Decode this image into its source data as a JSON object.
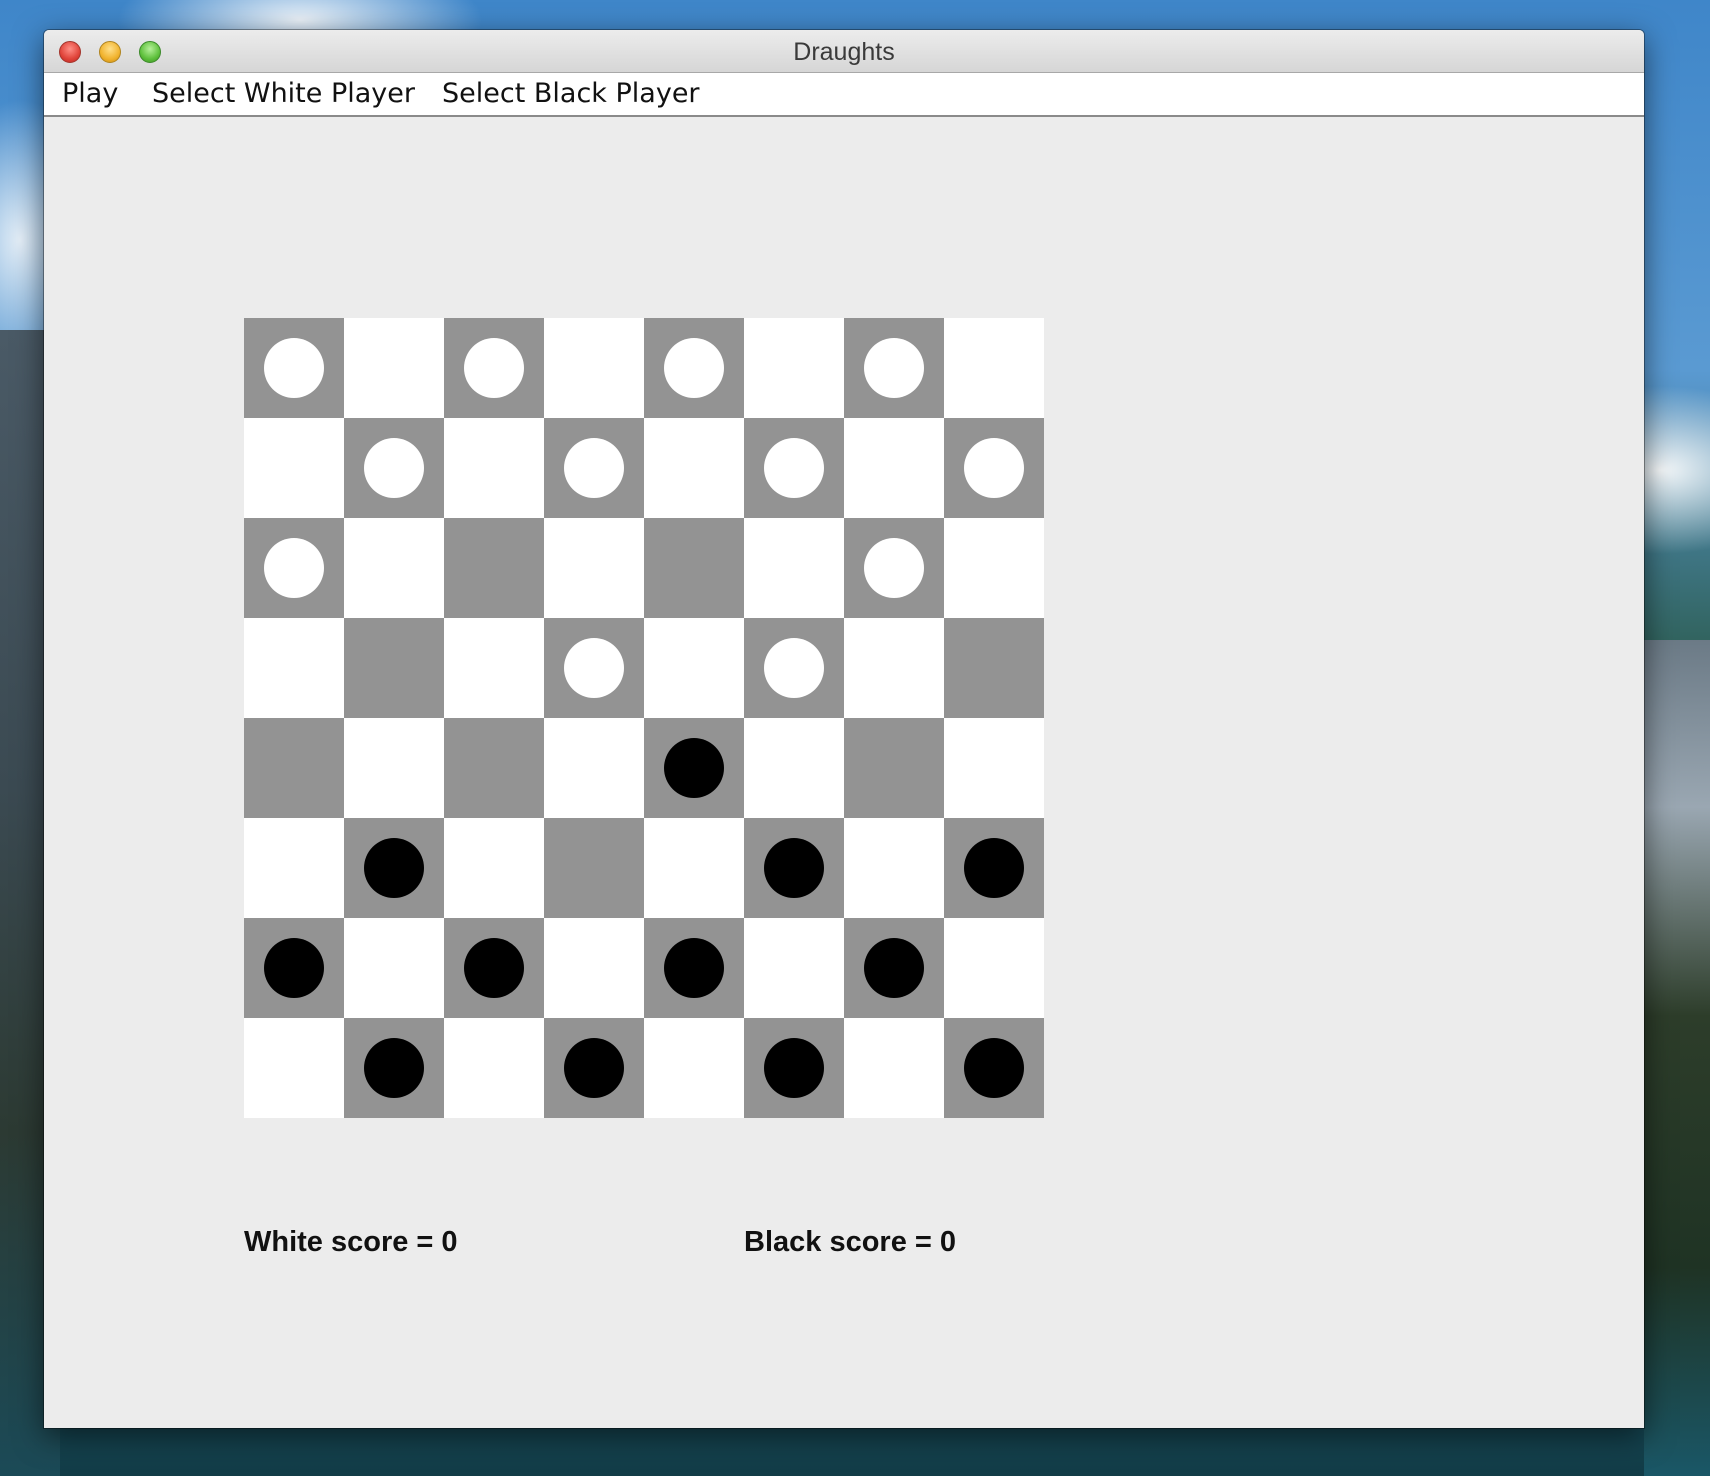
{
  "window": {
    "title": "Draughts"
  },
  "menu": {
    "items": [
      {
        "id": "play",
        "label": "Play"
      },
      {
        "id": "select-white",
        "label": "Select White Player"
      },
      {
        "id": "select-black",
        "label": "Select Black Player"
      }
    ]
  },
  "board": {
    "size": 8,
    "colors": {
      "dark_square": "#939393",
      "light_square": "#ffffff",
      "white_piece": "#ffffff",
      "black_piece": "#000000",
      "background": "#ececec"
    },
    "rows": [
      "W.W.W.W.",
      ".W.W.W.W",
      "W.....W.",
      "...W.W..",
      "....B...",
      ".B...B.B",
      "B.B.B.B.",
      ".B.B.B.B"
    ]
  },
  "scores": {
    "white_label": "White score = 0",
    "black_label": "Black score = 0"
  }
}
